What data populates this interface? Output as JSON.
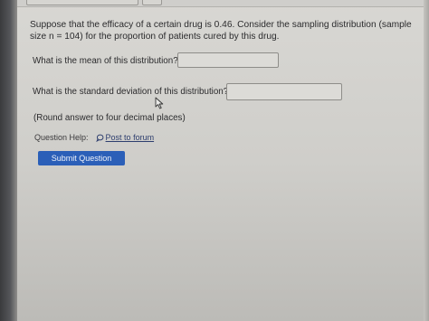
{
  "question": {
    "text": "Suppose that the efficacy of a certain drug is 0.46. Consider the sampling distribution (sample size n = 104) for the proportion of patients cured by this drug.",
    "part1_prompt": "What is the mean of this distribution?",
    "part1_value": "",
    "part2_prompt": "What is the standard deviation of this distribution?",
    "part2_value": "",
    "note": "(Round answer to four decimal places)"
  },
  "help": {
    "label": "Question Help:",
    "forum_label": "Post to forum",
    "forum_icon": "speech-bubble-icon"
  },
  "submit": {
    "label": "Submit Question",
    "color": "#2b5fb8"
  },
  "cursor_icon": "mouse-pointer-icon"
}
